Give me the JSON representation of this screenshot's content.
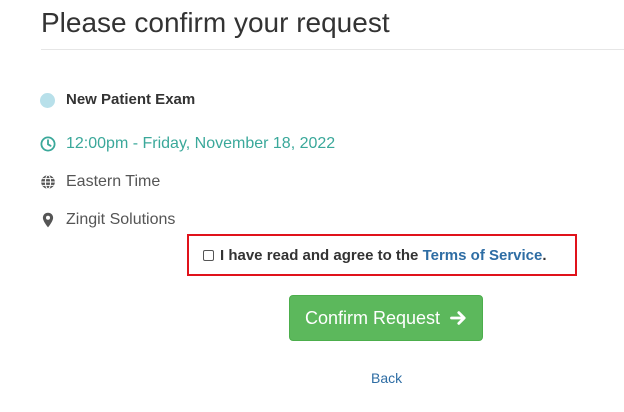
{
  "header": {
    "title": "Please confirm your request"
  },
  "details": {
    "service": {
      "label": "New Patient Exam",
      "dot_color": "#b8e0ea",
      "icon": "status-dot"
    },
    "time": {
      "label": "12:00pm - Friday, November 18, 2022",
      "icon": "clock-icon",
      "color": "#3aa89a"
    },
    "timezone": {
      "label": "Eastern Time",
      "icon": "globe-icon"
    },
    "location": {
      "label": "Zingit Solutions",
      "icon": "map-marker-icon"
    }
  },
  "terms": {
    "checked": false,
    "prefix": "I have read and agree to the ",
    "link_text": "Terms of Service",
    "suffix": ".",
    "highlight_color": "#e0121b"
  },
  "actions": {
    "confirm_label": "Confirm Request",
    "confirm_icon": "arrow-right-icon",
    "confirm_color": "#5cb85c",
    "back_label": "Back"
  }
}
